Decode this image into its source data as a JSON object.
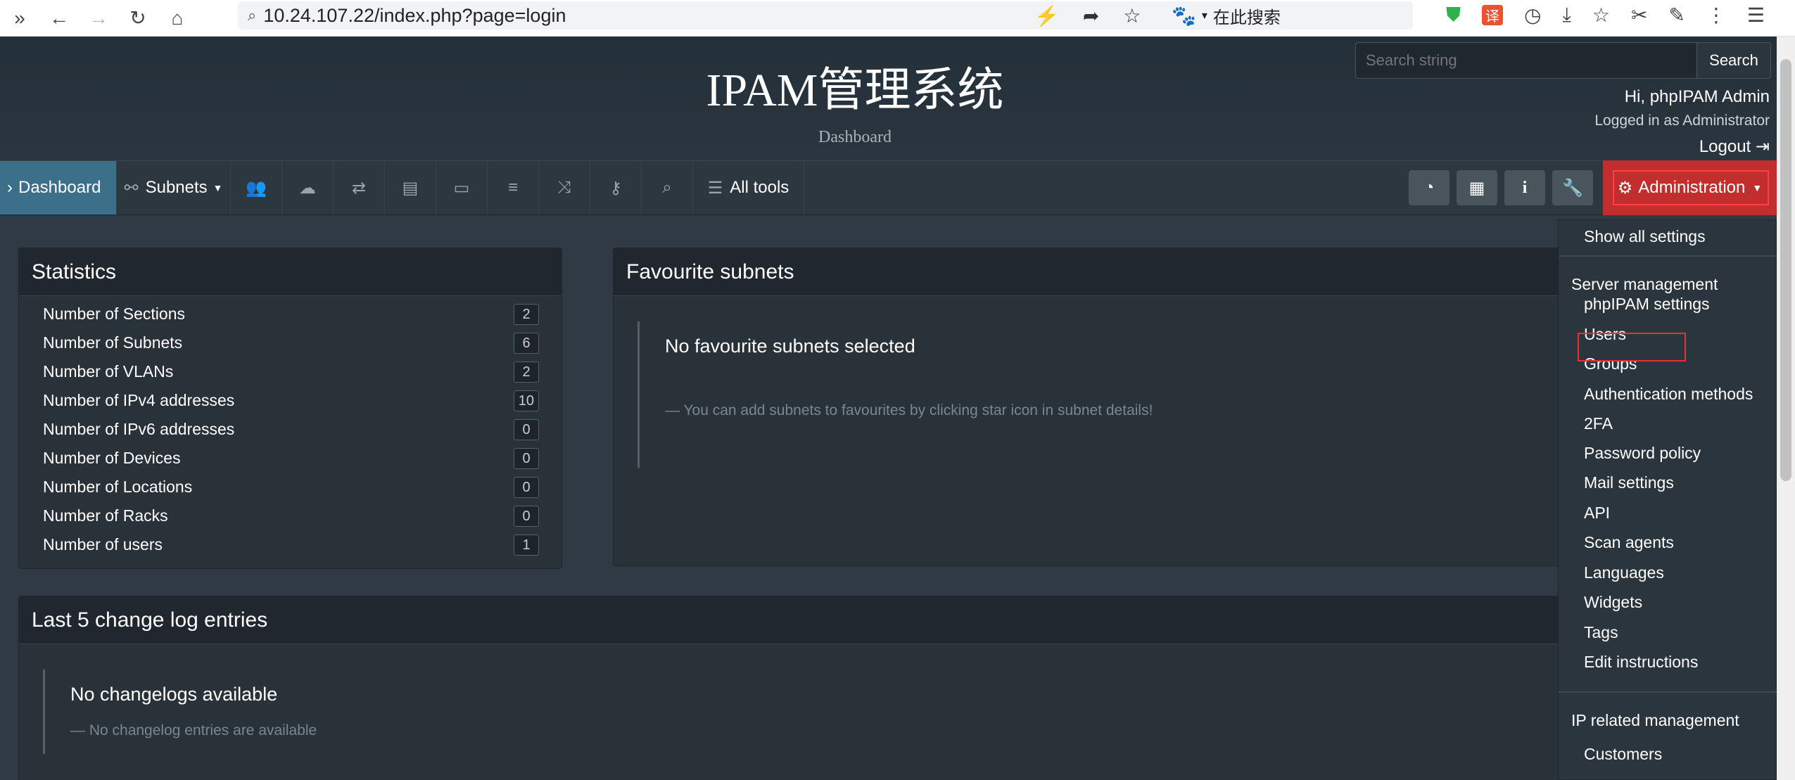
{
  "browser": {
    "url": "10.24.107.22/index.php?page=login",
    "search_engine_label": "在此搜索"
  },
  "header": {
    "title": "IPAM管理系统",
    "subtitle": "Dashboard",
    "search_placeholder": "Search string",
    "search_button": "Search",
    "greeting": "Hi, phpIPAM Admin",
    "logged_in_as": "Logged in as  Administrator",
    "logout": "Logout"
  },
  "navbar": {
    "dashboard": "Dashboard",
    "subnets": "Subnets",
    "all_tools": "All tools",
    "administration": "Administration"
  },
  "statistics": {
    "title": "Statistics",
    "rows": [
      {
        "label": "Number of Sections",
        "value": "2"
      },
      {
        "label": "Number of Subnets",
        "value": "6"
      },
      {
        "label": "Number of VLANs",
        "value": "2"
      },
      {
        "label": "Number of IPv4 addresses",
        "value": "10"
      },
      {
        "label": "Number of IPv6 addresses",
        "value": "0"
      },
      {
        "label": "Number of Devices",
        "value": "0"
      },
      {
        "label": "Number of Locations",
        "value": "0"
      },
      {
        "label": "Number of Racks",
        "value": "0"
      },
      {
        "label": "Number of users",
        "value": "1"
      }
    ]
  },
  "favourites": {
    "title": "Favourite subnets",
    "empty_title": "No favourite subnets selected",
    "empty_hint": "— You can add subnets to favourites by clicking star icon in subnet details!"
  },
  "changelog": {
    "title": "Last 5 change log entries",
    "empty_title": "No changelogs available",
    "empty_hint": "— No changelog entries are available"
  },
  "admin_menu": {
    "show_all": "Show all settings",
    "server_management": "Server management",
    "server_items": [
      "phpIPAM settings",
      "Users",
      "Groups",
      "Authentication methods",
      "2FA",
      "Password policy",
      "Mail settings",
      "API",
      "Scan agents",
      "Languages",
      "Widgets",
      "Tags",
      "Edit instructions"
    ],
    "ip_management": "IP related management",
    "ip_items": [
      "Customers"
    ]
  }
}
